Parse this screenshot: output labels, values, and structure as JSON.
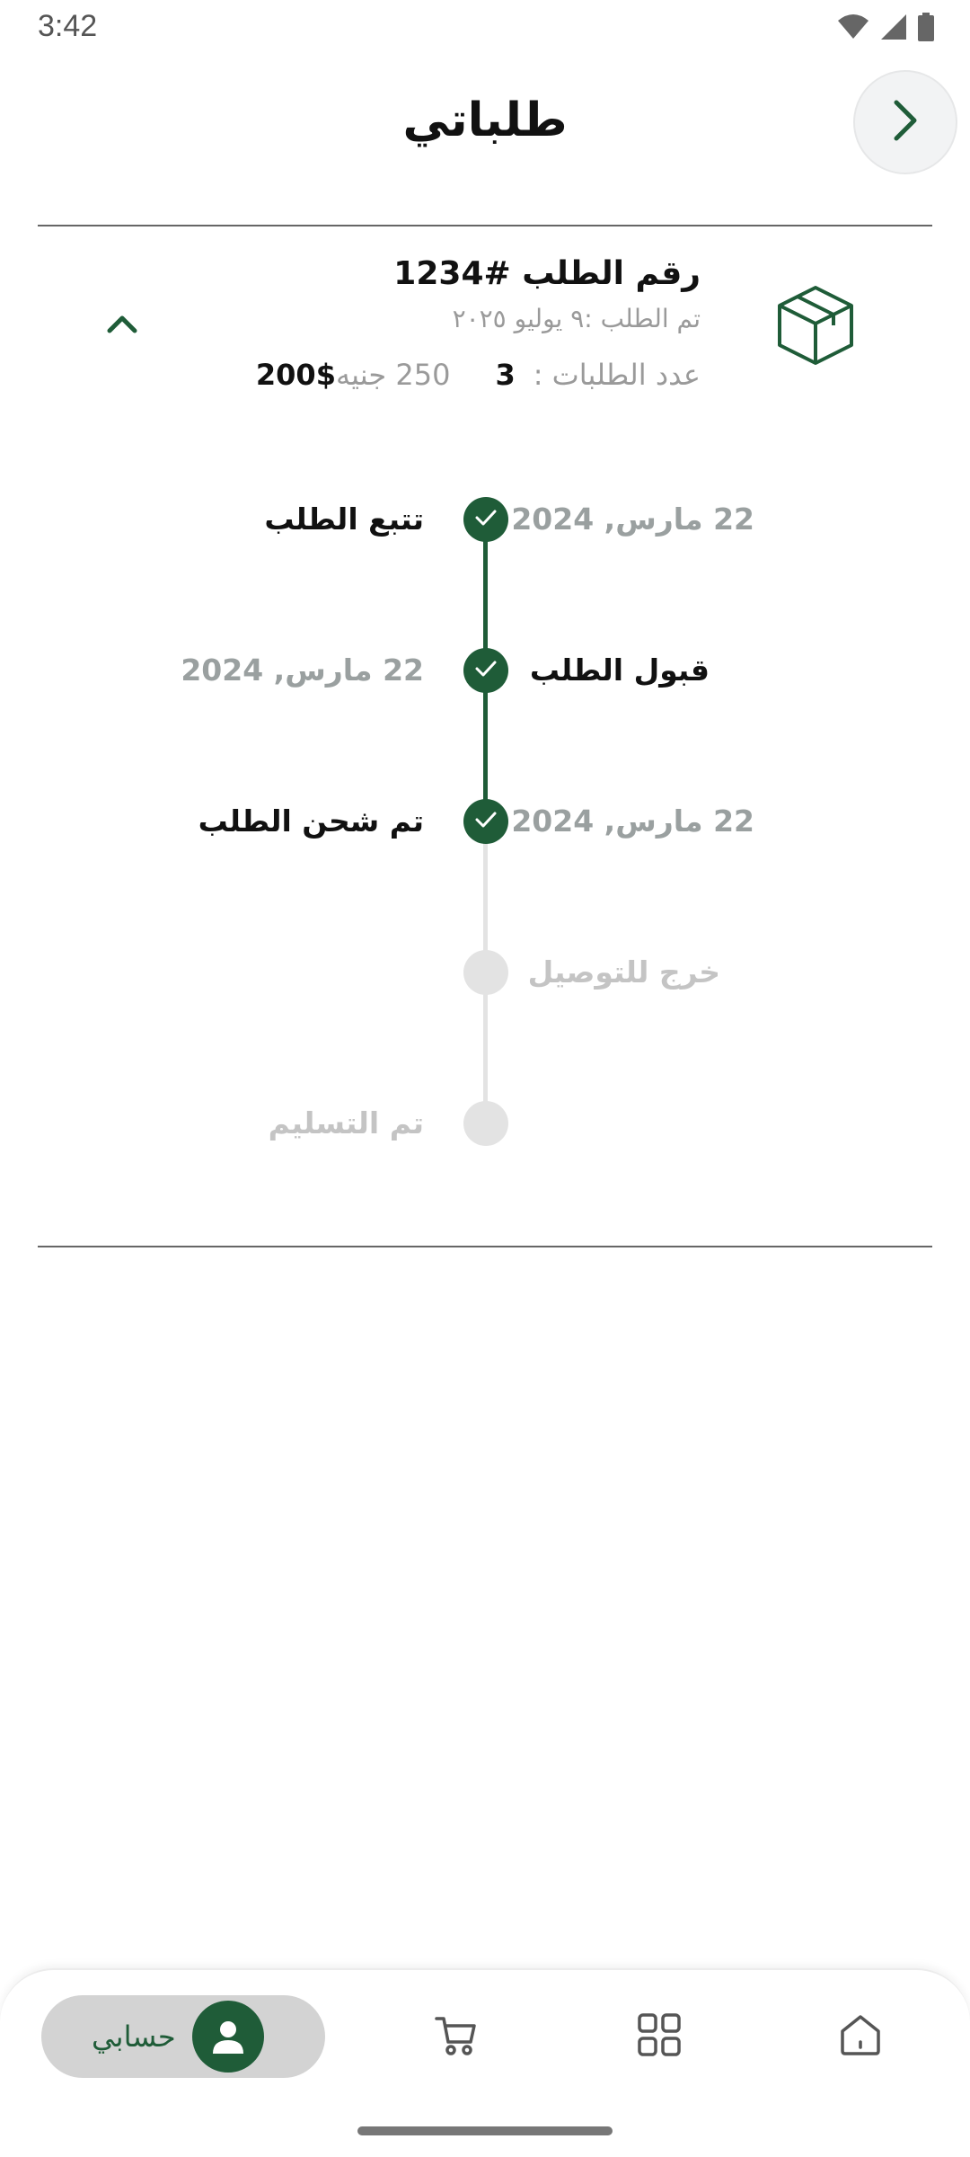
{
  "status_bar": {
    "time": "3:42"
  },
  "header": {
    "title": "طلباتي"
  },
  "order": {
    "number": "رقم الطلب #1234",
    "date": "تم الطلب :٩ يوليو ٢٠٢٥",
    "count_label": "عدد الطلبات :",
    "count_value": "3",
    "price_unit": "250 جنيه",
    "price_value": "200$"
  },
  "timeline": {
    "steps": [
      {
        "label": "تتبع الطلب",
        "date": "22 مارس, 2024",
        "status": "done"
      },
      {
        "label": "قبول الطلب",
        "date": "22 مارس, 2024",
        "status": "done"
      },
      {
        "label": "تم شحن الطلب",
        "date": "22 مارس, 2024",
        "status": "done"
      },
      {
        "label": "خرج للتوصيل",
        "date": "",
        "status": "pending"
      },
      {
        "label": "تم التسليم",
        "date": "",
        "status": "pending"
      }
    ]
  },
  "bottom_nav": {
    "account_label": "حسابي",
    "items": [
      "account-icon",
      "cart-icon",
      "categories-icon",
      "home-icon"
    ]
  },
  "colors": {
    "accent": "#1f5c38",
    "pending": "#e3e3e3",
    "muted": "#9aa0a0"
  }
}
